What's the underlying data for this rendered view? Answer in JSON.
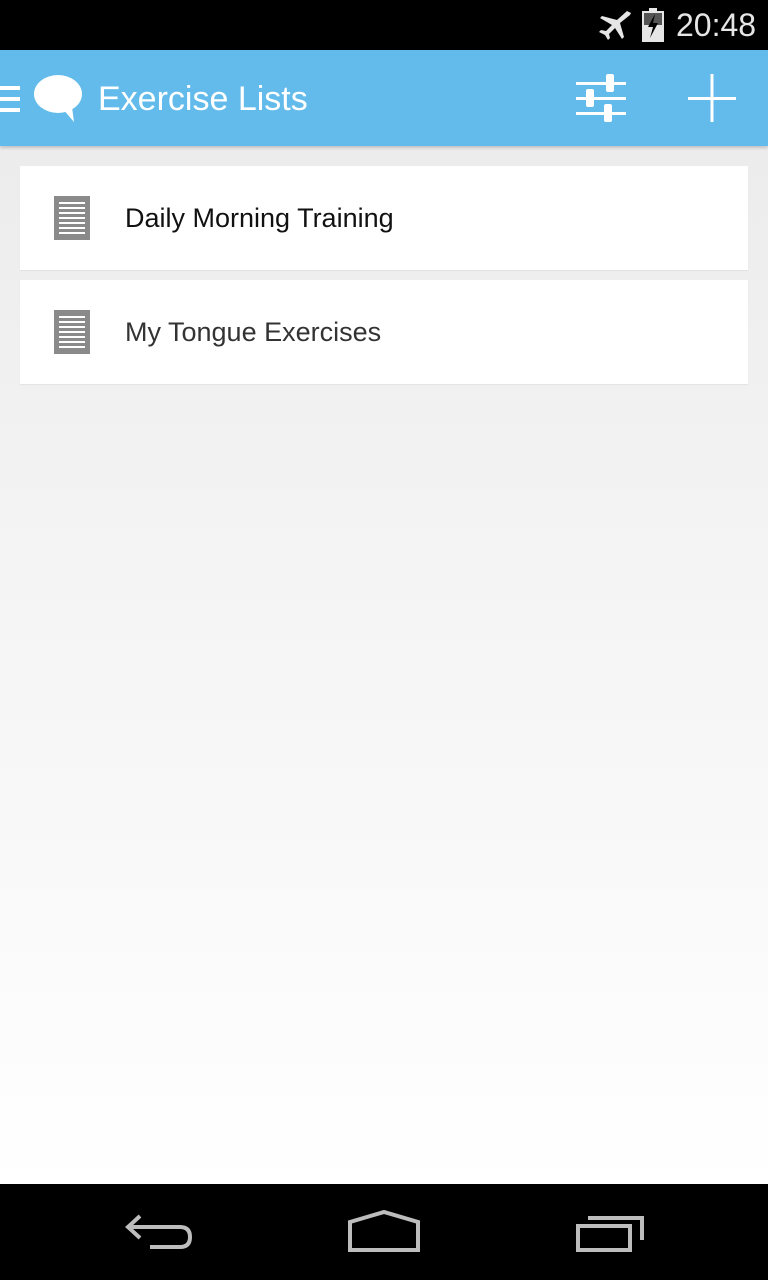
{
  "status_bar": {
    "time": "20:48",
    "icons": [
      "airplane-icon",
      "battery-charging-icon"
    ],
    "color": "#e6e6e6"
  },
  "action_bar": {
    "title": "Exercise Lists",
    "background_color": "#62bbea",
    "icons": [
      "drawer-icon",
      "speech-bubble-icon",
      "sliders-icon",
      "plus-icon"
    ]
  },
  "exercise_lists": {
    "items": [
      {
        "label": "Daily Morning Training",
        "icon": "document-icon"
      },
      {
        "label": "My Tongue Exercises",
        "icon": "document-icon"
      }
    ]
  },
  "nav_bar": {
    "icons": [
      "back-icon",
      "home-icon",
      "recents-icon"
    ]
  }
}
